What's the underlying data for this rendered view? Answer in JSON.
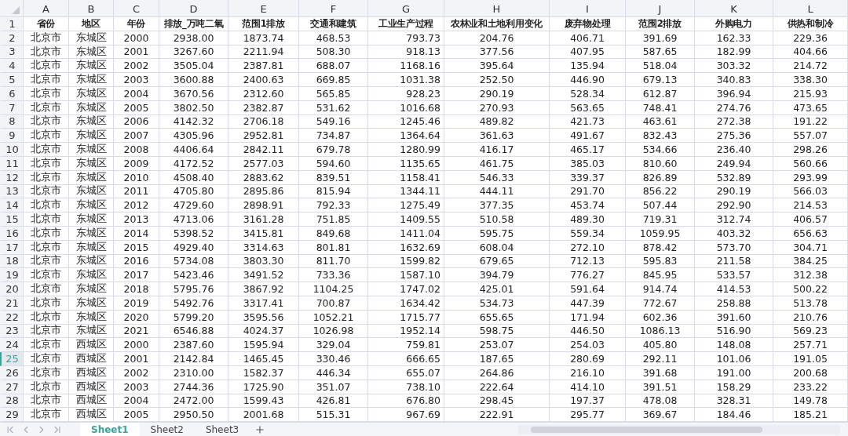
{
  "columns": [
    "A",
    "B",
    "C",
    "D",
    "E",
    "F",
    "G",
    "H",
    "I",
    "J",
    "K",
    "L"
  ],
  "header_row": {
    "number": "1",
    "cells": [
      "省份",
      "地区",
      "年份",
      "排放_万吨二氧",
      "范围1排放",
      "交通和建筑",
      "工业生产过程",
      "农林业和土地利用变化",
      "废弃物处理",
      "范围2排放",
      "外购电力",
      "供热和制冷"
    ]
  },
  "rows": [
    {
      "number": "2",
      "selected": false,
      "cells": [
        "北京市",
        "东城区",
        "2000",
        "2938.00",
        "1873.74",
        "468.53",
        "793.73",
        "204.76",
        "406.71",
        "391.69",
        "162.33",
        "229.36"
      ]
    },
    {
      "number": "3",
      "selected": false,
      "cells": [
        "北京市",
        "东城区",
        "2001",
        "3267.60",
        "2211.94",
        "508.30",
        "918.13",
        "377.56",
        "407.95",
        "587.65",
        "182.99",
        "404.66"
      ]
    },
    {
      "number": "4",
      "selected": false,
      "cells": [
        "北京市",
        "东城区",
        "2002",
        "3505.04",
        "2387.81",
        "688.07",
        "1168.16",
        "395.64",
        "135.94",
        "518.04",
        "303.32",
        "214.72"
      ]
    },
    {
      "number": "5",
      "selected": false,
      "cells": [
        "北京市",
        "东城区",
        "2003",
        "3600.88",
        "2400.63",
        "669.85",
        "1031.38",
        "252.50",
        "446.90",
        "679.13",
        "340.83",
        "338.30"
      ]
    },
    {
      "number": "6",
      "selected": false,
      "cells": [
        "北京市",
        "东城区",
        "2004",
        "3670.56",
        "2312.60",
        "565.85",
        "928.23",
        "290.19",
        "528.34",
        "612.87",
        "396.94",
        "215.93"
      ]
    },
    {
      "number": "7",
      "selected": false,
      "cells": [
        "北京市",
        "东城区",
        "2005",
        "3802.50",
        "2382.87",
        "531.62",
        "1016.68",
        "270.93",
        "563.65",
        "748.41",
        "274.76",
        "473.65"
      ]
    },
    {
      "number": "8",
      "selected": false,
      "cells": [
        "北京市",
        "东城区",
        "2006",
        "4142.32",
        "2706.18",
        "549.16",
        "1245.46",
        "489.82",
        "421.73",
        "463.61",
        "272.38",
        "191.22"
      ]
    },
    {
      "number": "9",
      "selected": false,
      "cells": [
        "北京市",
        "东城区",
        "2007",
        "4305.96",
        "2952.81",
        "734.87",
        "1364.64",
        "361.63",
        "491.67",
        "832.43",
        "275.36",
        "557.07"
      ]
    },
    {
      "number": "10",
      "selected": false,
      "cells": [
        "北京市",
        "东城区",
        "2008",
        "4406.64",
        "2842.11",
        "679.78",
        "1280.99",
        "416.17",
        "465.17",
        "534.66",
        "236.40",
        "298.26"
      ]
    },
    {
      "number": "11",
      "selected": false,
      "cells": [
        "北京市",
        "东城区",
        "2009",
        "4172.52",
        "2577.03",
        "594.60",
        "1135.65",
        "461.75",
        "385.03",
        "810.60",
        "249.94",
        "560.66"
      ]
    },
    {
      "number": "12",
      "selected": false,
      "cells": [
        "北京市",
        "东城区",
        "2010",
        "4508.40",
        "2883.62",
        "839.51",
        "1158.41",
        "546.33",
        "339.37",
        "826.89",
        "532.89",
        "293.99"
      ]
    },
    {
      "number": "13",
      "selected": false,
      "cells": [
        "北京市",
        "东城区",
        "2011",
        "4705.80",
        "2895.86",
        "815.94",
        "1344.11",
        "444.11",
        "291.70",
        "856.22",
        "290.19",
        "566.03"
      ]
    },
    {
      "number": "14",
      "selected": false,
      "cells": [
        "北京市",
        "东城区",
        "2012",
        "4729.60",
        "2898.91",
        "792.33",
        "1275.49",
        "377.35",
        "453.74",
        "507.44",
        "292.90",
        "214.53"
      ]
    },
    {
      "number": "15",
      "selected": false,
      "cells": [
        "北京市",
        "东城区",
        "2013",
        "4713.06",
        "3161.28",
        "751.85",
        "1409.55",
        "510.58",
        "489.30",
        "719.31",
        "312.74",
        "406.57"
      ]
    },
    {
      "number": "16",
      "selected": false,
      "cells": [
        "北京市",
        "东城区",
        "2014",
        "5398.52",
        "3415.81",
        "849.68",
        "1411.04",
        "595.75",
        "559.34",
        "1059.95",
        "403.32",
        "656.63"
      ]
    },
    {
      "number": "17",
      "selected": false,
      "cells": [
        "北京市",
        "东城区",
        "2015",
        "4929.40",
        "3314.63",
        "801.81",
        "1632.69",
        "608.04",
        "272.10",
        "878.42",
        "573.70",
        "304.71"
      ]
    },
    {
      "number": "18",
      "selected": false,
      "cells": [
        "北京市",
        "东城区",
        "2016",
        "5734.08",
        "3803.30",
        "811.70",
        "1599.82",
        "679.65",
        "712.13",
        "595.83",
        "211.58",
        "384.25"
      ]
    },
    {
      "number": "19",
      "selected": false,
      "cells": [
        "北京市",
        "东城区",
        "2017",
        "5423.46",
        "3491.52",
        "733.36",
        "1587.10",
        "394.79",
        "776.27",
        "845.95",
        "533.57",
        "312.38"
      ]
    },
    {
      "number": "20",
      "selected": false,
      "cells": [
        "北京市",
        "东城区",
        "2018",
        "5795.76",
        "3867.92",
        "1104.25",
        "1747.02",
        "425.01",
        "591.64",
        "914.74",
        "414.53",
        "500.22"
      ]
    },
    {
      "number": "21",
      "selected": false,
      "cells": [
        "北京市",
        "东城区",
        "2019",
        "5492.76",
        "3317.41",
        "700.87",
        "1634.42",
        "534.73",
        "447.39",
        "772.67",
        "258.88",
        "513.78"
      ]
    },
    {
      "number": "22",
      "selected": false,
      "cells": [
        "北京市",
        "东城区",
        "2020",
        "5799.20",
        "3595.56",
        "1052.21",
        "1715.77",
        "655.65",
        "171.94",
        "602.36",
        "391.60",
        "210.76"
      ]
    },
    {
      "number": "23",
      "selected": false,
      "cells": [
        "北京市",
        "东城区",
        "2021",
        "6546.88",
        "4024.37",
        "1026.98",
        "1952.14",
        "598.75",
        "446.50",
        "1086.13",
        "516.90",
        "569.23"
      ]
    },
    {
      "number": "24",
      "selected": false,
      "cells": [
        "北京市",
        "西城区",
        "2000",
        "2387.60",
        "1595.94",
        "329.04",
        "759.81",
        "253.07",
        "254.03",
        "405.80",
        "148.08",
        "257.71"
      ]
    },
    {
      "number": "25",
      "selected": true,
      "cells": [
        "北京市",
        "西城区",
        "2001",
        "2142.84",
        "1465.45",
        "330.46",
        "666.65",
        "187.65",
        "280.69",
        "292.11",
        "101.06",
        "191.05"
      ]
    },
    {
      "number": "26",
      "selected": false,
      "cells": [
        "北京市",
        "西城区",
        "2002",
        "2310.00",
        "1582.37",
        "446.34",
        "655.07",
        "264.86",
        "216.10",
        "391.68",
        "191.00",
        "200.68"
      ]
    },
    {
      "number": "27",
      "selected": false,
      "cells": [
        "北京市",
        "西城区",
        "2003",
        "2744.36",
        "1725.90",
        "351.07",
        "738.10",
        "222.64",
        "414.10",
        "391.51",
        "158.29",
        "233.22"
      ]
    },
    {
      "number": "28",
      "selected": false,
      "cells": [
        "北京市",
        "西城区",
        "2004",
        "2472.00",
        "1599.43",
        "426.81",
        "676.80",
        "298.45",
        "197.37",
        "478.08",
        "328.31",
        "149.78"
      ]
    },
    {
      "number": "29",
      "selected": false,
      "cells": [
        "北京市",
        "西城区",
        "2005",
        "2950.50",
        "2001.68",
        "515.31",
        "967.69",
        "222.91",
        "295.77",
        "369.67",
        "184.46",
        "185.21"
      ]
    }
  ],
  "sheet_tabs": [
    {
      "label": "Sheet1",
      "selected": true
    },
    {
      "label": "Sheet2",
      "selected": false
    },
    {
      "label": "Sheet3",
      "selected": false
    }
  ]
}
